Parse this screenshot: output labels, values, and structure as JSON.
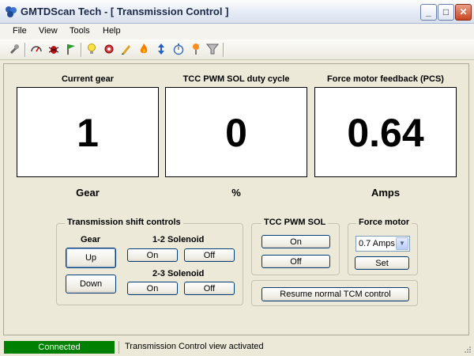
{
  "window": {
    "title": "GMTDScan Tech - [ Transmission Control ]"
  },
  "menu": {
    "items": [
      "File",
      "View",
      "Tools",
      "Help"
    ]
  },
  "toolbar": {
    "icons": [
      "scan-tool-icon",
      "gauge-icon",
      "bug-icon",
      "flag-icon",
      "lightbulb-icon",
      "gear-settings-icon",
      "pencil-icon",
      "flame-icon",
      "up-down-arrows-icon",
      "stopwatch-icon",
      "pin-icon",
      "filter-icon"
    ]
  },
  "gauges": [
    {
      "title": "Current gear",
      "value": "1",
      "unit": "Gear"
    },
    {
      "title": "TCC PWM SOL duty cycle",
      "value": "0",
      "unit": "%"
    },
    {
      "title": "Force motor feedback (PCS)",
      "value": "0.64",
      "unit": "Amps"
    }
  ],
  "shift_controls": {
    "title": "Transmission shift controls",
    "gear_label": "Gear",
    "up": "Up",
    "down": "Down",
    "sol12_label": "1-2 Solenoid",
    "sol12_on": "On",
    "sol12_off": "Off",
    "sol23_label": "2-3 Solenoid",
    "sol23_on": "On",
    "sol23_off": "Off"
  },
  "tcc": {
    "title": "TCC PWM SOL",
    "on": "On",
    "off": "Off"
  },
  "force_motor": {
    "title": "Force motor",
    "selected": "0.7 Amps",
    "set": "Set"
  },
  "resume_button": "Resume normal TCM control",
  "status": {
    "connection": "Connected",
    "message": "Transmission Control view activated",
    "connection_color": "#008000"
  }
}
